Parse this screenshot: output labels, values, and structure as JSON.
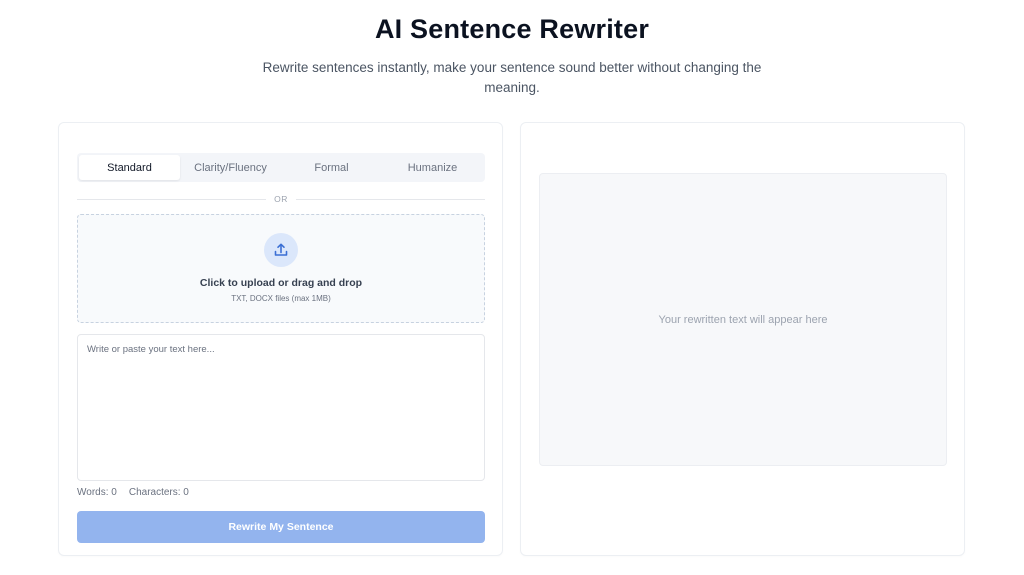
{
  "header": {
    "title": "AI Sentence Rewriter",
    "subtitle": "Rewrite sentences instantly, make your sentence sound better without changing the meaning."
  },
  "editor": {
    "tabs": [
      {
        "label": "Standard",
        "active": true
      },
      {
        "label": "Clarity/Fluency",
        "active": false
      },
      {
        "label": "Formal",
        "active": false
      },
      {
        "label": "Humanize",
        "active": false
      }
    ],
    "divider_label": "OR",
    "upload": {
      "icon": "upload-icon",
      "title": "Click to upload or drag and drop",
      "hint": "TXT, DOCX files (max 1MB)"
    },
    "input": {
      "value": "",
      "placeholder": "Write or paste your text here..."
    },
    "counts": {
      "words_label": "Words: 0",
      "characters_label": "Characters: 0"
    },
    "submit_label": "Rewrite My Sentence"
  },
  "output": {
    "placeholder": "Your rewritten text will appear here"
  },
  "colors": {
    "accent": "#93b4ee",
    "upload_icon_bg": "#dbe7fb",
    "upload_icon_stroke": "#3b6fd4"
  }
}
